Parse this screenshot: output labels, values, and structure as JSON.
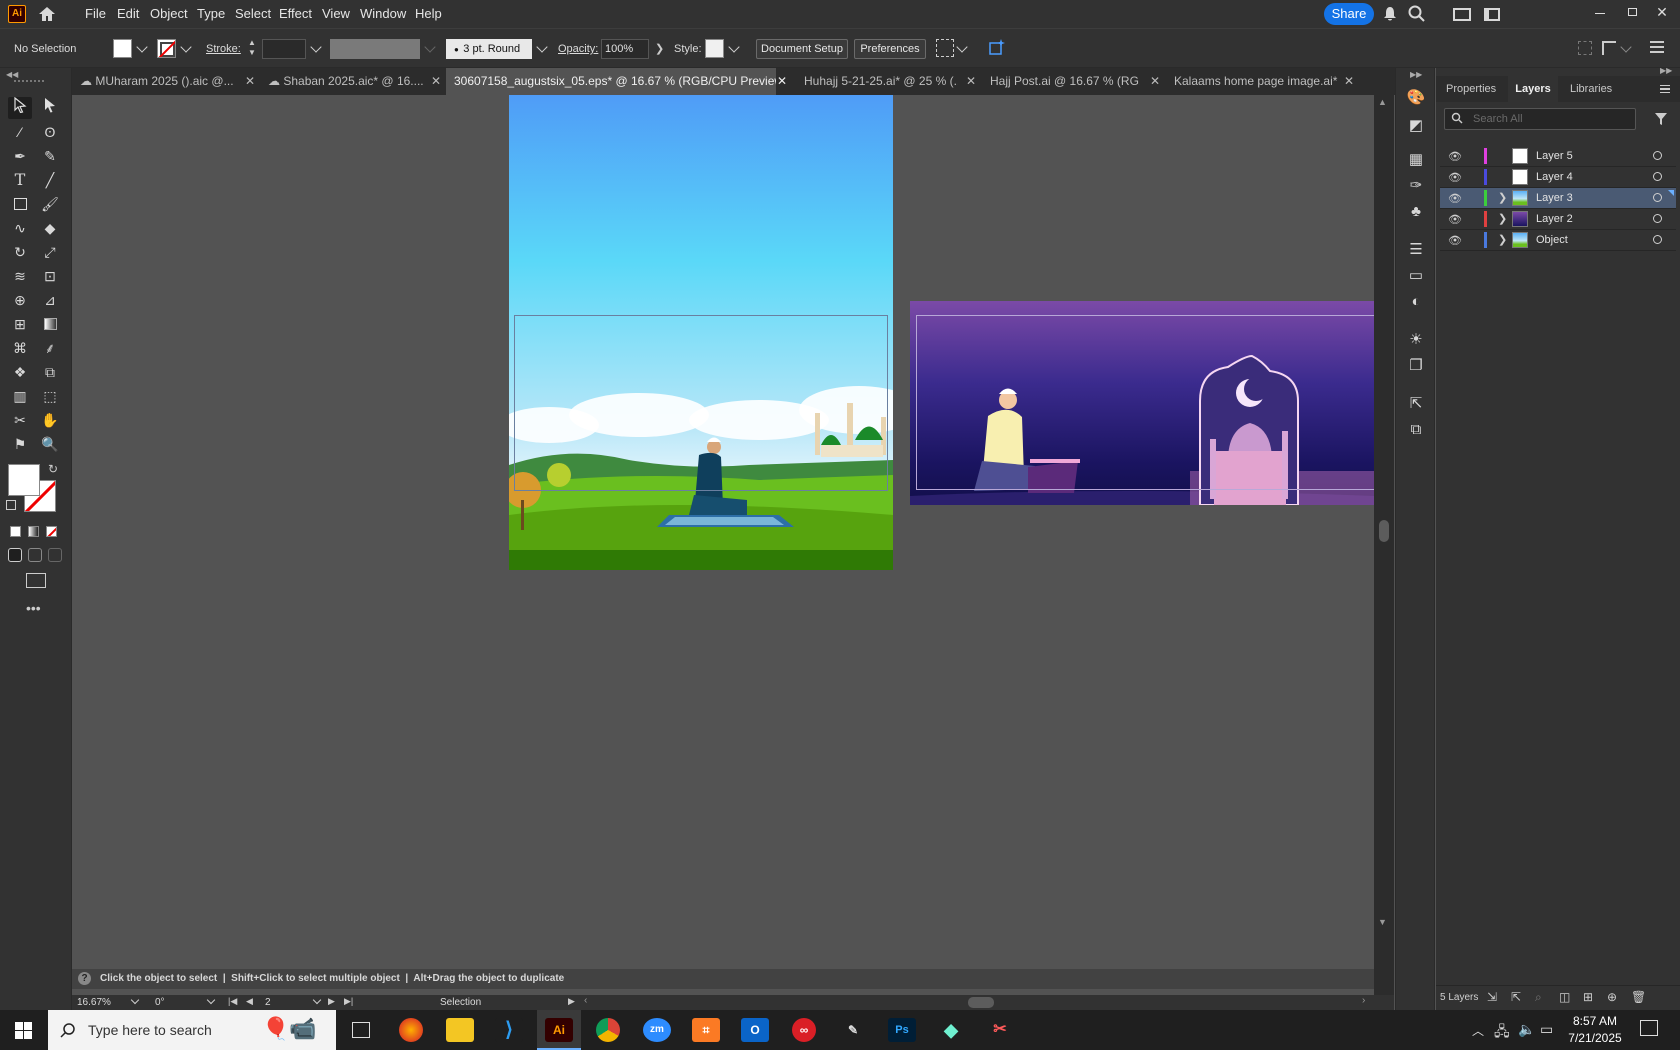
{
  "app": {
    "logo": "Ai",
    "share_label": "Share"
  },
  "menu": [
    "File",
    "Edit",
    "Object",
    "Type",
    "Select",
    "Effect",
    "View",
    "Window",
    "Help"
  ],
  "control": {
    "selection": "No Selection",
    "stroke_label": "Stroke:",
    "brush": "3 pt. Round",
    "opacity_label": "Opacity:",
    "opacity_value": "100%",
    "style_label": "Style:",
    "doc_setup": "Document Setup",
    "preferences": "Preferences"
  },
  "tabs": [
    {
      "label": "MUharam 2025 ().aic @..."
    },
    {
      "label": "Shaban 2025.aic* @ 16...."
    },
    {
      "label": "30607158_augustsix_05.eps* @ 16.67 % (RGB/CPU Preview)"
    },
    {
      "label": "Huhajj 5-21-25.ai* @ 25 % (..."
    },
    {
      "label": "Hajj Post.ai @ 16.67 % (RG..."
    },
    {
      "label": "Kalaams home page image.ai*"
    }
  ],
  "panel": {
    "tabs": [
      "Properties",
      "Layers",
      "Libraries"
    ],
    "search_placeholder": "Search All",
    "layers": [
      {
        "name": "Layer 5",
        "color": "#e040e0"
      },
      {
        "name": "Layer 4",
        "color": "#4a4adf"
      },
      {
        "name": "Layer 3",
        "color": "#3ccf3c"
      },
      {
        "name": "Layer 2",
        "color": "#e04040"
      },
      {
        "name": "Object",
        "color": "#4a7adf"
      }
    ],
    "footer": "5 Layers"
  },
  "status": {
    "hint": "Click the object to select  |  Shift+Click to select multiple object  |  Alt+Drag the object to duplicate",
    "zoom": "16.67%",
    "rotation": "0°",
    "artboard": "2",
    "tool": "Selection"
  },
  "taskbar": {
    "search_placeholder": "Type here to search",
    "time": "8:57 AM",
    "date": "7/21/2025"
  }
}
